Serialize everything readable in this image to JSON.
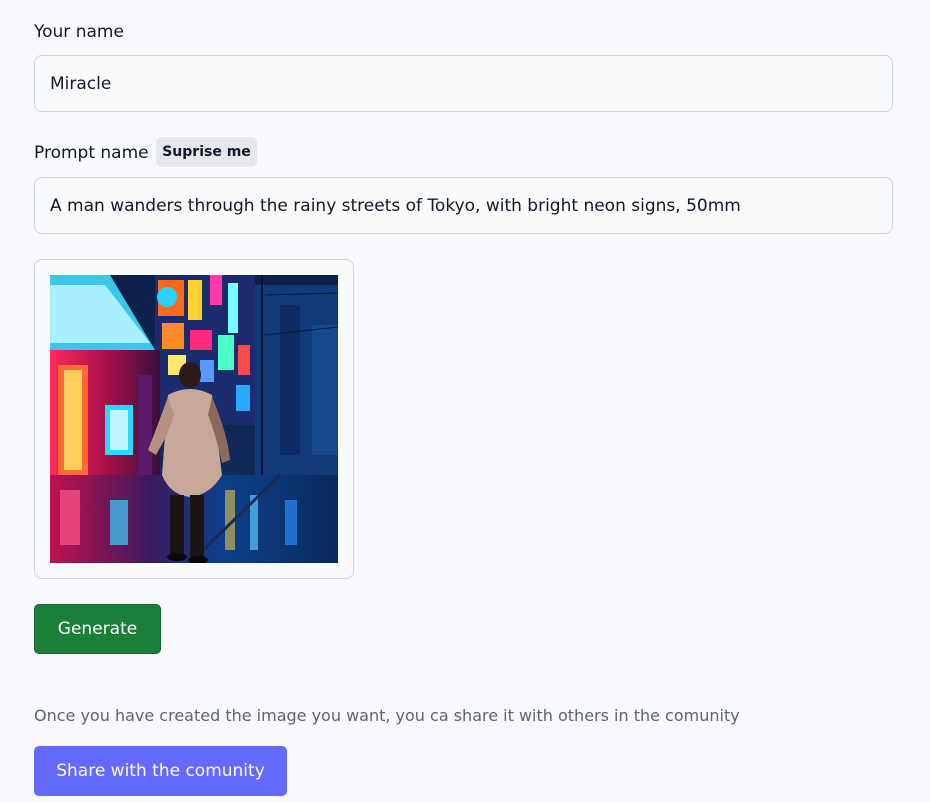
{
  "form": {
    "name_label": "Your name",
    "name_value": "Miracle",
    "prompt_label": "Prompt name",
    "surprise_label": "Suprise me",
    "prompt_value": "A man wanders through the rainy streets of Tokyo, with bright neon signs, 50mm"
  },
  "preview": {
    "image_subject": "man walking in rainy neon-lit Tokyo street at night"
  },
  "actions": {
    "generate_label": "Generate",
    "share_note": "Once you have created the image you want, you ca share it with others in the comunity",
    "share_label": "Share with the comunity"
  },
  "colors": {
    "background": "#f8f9fc",
    "generate_green": "#1b7f38",
    "share_purple": "#6469ff",
    "surprise_gray": "#e6e7eb"
  }
}
